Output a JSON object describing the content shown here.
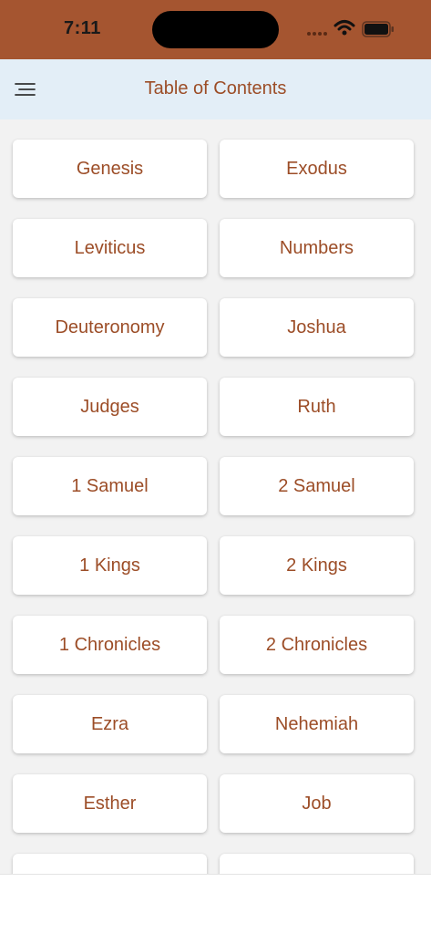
{
  "status_bar": {
    "time": "7:11",
    "background": "#a55530"
  },
  "nav": {
    "title": "Table of Contents",
    "menu_icon": "menu-icon",
    "background": "#e3eef7"
  },
  "accent_color": "#9c4d27",
  "books": [
    "Genesis",
    "Exodus",
    "Leviticus",
    "Numbers",
    "Deuteronomy",
    "Joshua",
    "Judges",
    "Ruth",
    "1 Samuel",
    "2 Samuel",
    "1 Kings",
    "2 Kings",
    "1 Chronicles",
    "2 Chronicles",
    "Ezra",
    "Nehemiah",
    "Esther",
    "Job",
    "",
    ""
  ]
}
